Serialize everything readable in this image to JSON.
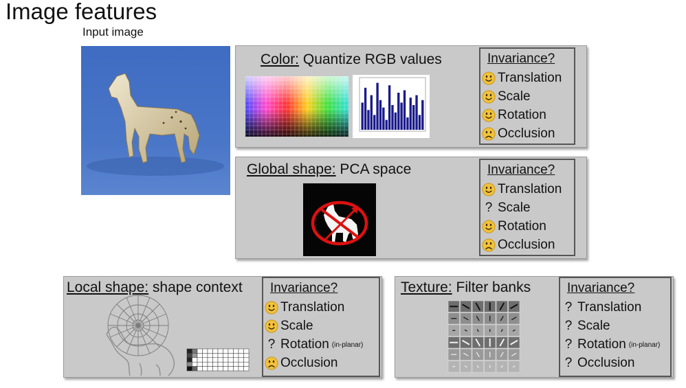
{
  "title": "Image features",
  "input_image_label": "Input image",
  "colors": {
    "panel": "#c9c9c9",
    "photo_bg": "#3d6ac0",
    "histogram_bar": "#1a1a8c",
    "face": "#f2c23a",
    "no_symbol": "#dd1111"
  },
  "panels": [
    {
      "id": "color",
      "heading_underlined": "Color:",
      "heading_rest": " Quantize RGB values",
      "invariance_title": "Invariance?",
      "items": [
        {
          "mark": "smile",
          "label": "Translation",
          "note": ""
        },
        {
          "mark": "smile",
          "label": "Scale",
          "note": ""
        },
        {
          "mark": "smile",
          "label": "Rotation",
          "note": ""
        },
        {
          "mark": "frown",
          "label": "Occlusion",
          "note": ""
        }
      ]
    },
    {
      "id": "global-shape",
      "heading_underlined": "Global shape:",
      "heading_rest": " PCA space",
      "invariance_title": "Invariance?",
      "items": [
        {
          "mark": "smile",
          "label": "Translation",
          "note": ""
        },
        {
          "mark": "?",
          "label": "Scale",
          "note": ""
        },
        {
          "mark": "smile",
          "label": "Rotation",
          "note": ""
        },
        {
          "mark": "frown",
          "label": "Occlusion",
          "note": ""
        }
      ]
    },
    {
      "id": "local-shape",
      "heading_underlined": "Local shape:",
      "heading_rest": " shape context",
      "invariance_title": "Invariance?",
      "items": [
        {
          "mark": "smile",
          "label": "Translation",
          "note": ""
        },
        {
          "mark": "smile",
          "label": "Scale",
          "note": ""
        },
        {
          "mark": "?",
          "label": "Rotation",
          "note": "(in-planar)"
        },
        {
          "mark": "frown",
          "label": "Occlusion",
          "note": ""
        }
      ]
    },
    {
      "id": "texture",
      "heading_underlined": "Texture:",
      "heading_rest": " Filter banks",
      "invariance_title": "Invariance?",
      "items": [
        {
          "mark": "?",
          "label": "Translation",
          "note": ""
        },
        {
          "mark": "?",
          "label": "Scale",
          "note": ""
        },
        {
          "mark": "?",
          "label": "Rotation",
          "note": "(in-planar)"
        },
        {
          "mark": "?",
          "label": "Occlusion",
          "note": ""
        }
      ]
    }
  ],
  "histogram_values": [
    0.55,
    0.85,
    0.4,
    0.7,
    0.3,
    0.95,
    0.6,
    0.45,
    0.2,
    0.9,
    0.5,
    0.35,
    0.75,
    0.55,
    0.8,
    0.25,
    0.65,
    0.5,
    0.7,
    0.3,
    0.6
  ]
}
